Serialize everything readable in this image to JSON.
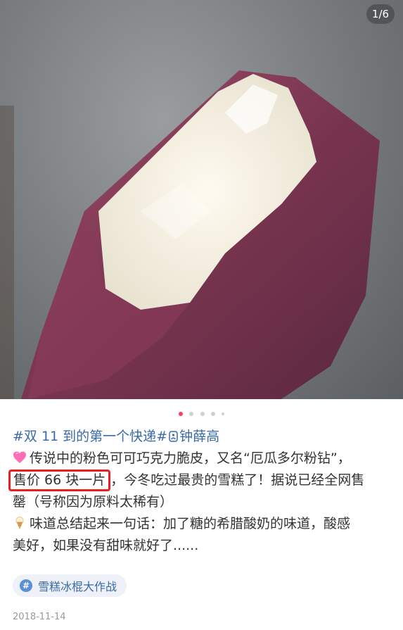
{
  "photo": {
    "counter": "1/6"
  },
  "carousel": {
    "current": 1,
    "total": 5
  },
  "post": {
    "title_topic": "#双 11 到的第一个快递#",
    "title_user": "钟薛高",
    "line1": "传说中的粉色可可巧克力脆皮，又名“厄瓜多尔粉钻”，",
    "price_highlight": "售价 66 块一片",
    "line2_rest": "，今冬吃过最贵的雪糕了！据说已经全网售",
    "line3": "罄（号称因为原料太稀有）",
    "line4": "味道总结起来一句话：加了糖的希腊酸奶的味道，酸感",
    "line5": "美好，如果没有甜味就好了......"
  },
  "tag": {
    "label": "雪糕冰棍大作战",
    "icon": "#"
  },
  "meta": {
    "date": "2018-11-14"
  },
  "icons": {
    "heart": "pink-heart-icon",
    "ice_cream": "ice-cream-icon",
    "user": "user-icon"
  },
  "colors": {
    "accent": "#ee1d23",
    "link": "#3a6aa8",
    "dot_active": "#ff3b5c"
  }
}
